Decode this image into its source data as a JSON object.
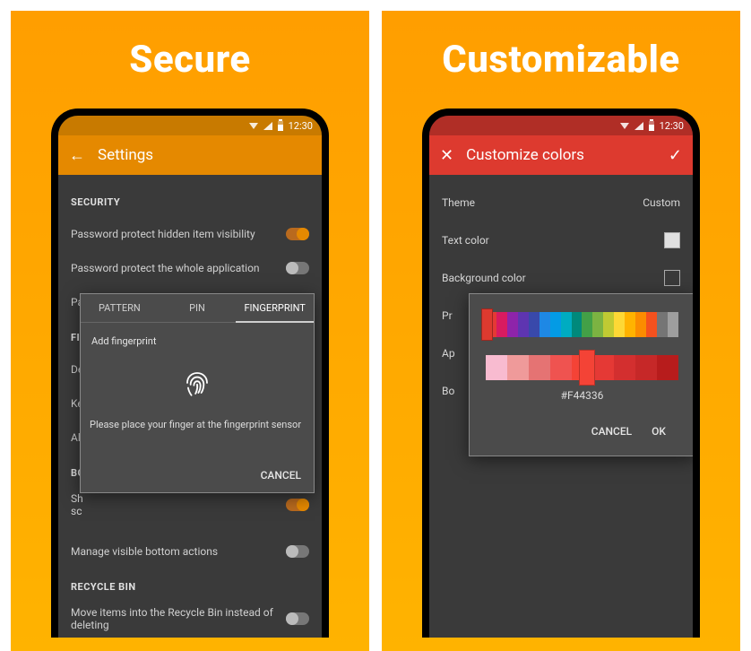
{
  "promos": {
    "left": "Secure",
    "right": "Customizable"
  },
  "statusbar": {
    "time": "12:30"
  },
  "left": {
    "title": "Settings",
    "sections": {
      "security": {
        "header": "SECURITY",
        "items": [
          "Password protect hidden item visibility",
          "Password protect the whole application",
          "Password protect file deletion and moving"
        ]
      },
      "fi": {
        "header": "FI",
        "items": [
          "De",
          "Ke",
          "Al"
        ]
      },
      "bo": {
        "header": "BO",
        "item": "Sh\nsc"
      },
      "bottom": "Manage visible bottom actions",
      "recycle": {
        "header": "RECYCLE BIN",
        "item": "Move items into the Recycle Bin instead of deleting"
      }
    },
    "dialog": {
      "tabs": [
        "PATTERN",
        "PIN",
        "FINGERPRINT"
      ],
      "subtitle": "Add fingerprint",
      "prompt": "Please place your finger at the fingerprint sensor",
      "cancel": "CANCEL"
    }
  },
  "right": {
    "title": "Customize colors",
    "theme_label": "Theme",
    "theme_value": "Custom",
    "options": [
      {
        "label": "Text color",
        "color": "#e0e0e0"
      },
      {
        "label": "Background color",
        "color": "#3a3a3a"
      },
      {
        "label": "Pr",
        "color": "#f44336"
      },
      {
        "label": "Ap",
        "color": "#f44336"
      },
      {
        "label": "Bo",
        "color": "#3a3a3a"
      }
    ],
    "dialog": {
      "hue_colors": [
        "#e53935",
        "#d81b60",
        "#8e24aa",
        "#5e35b1",
        "#3949ab",
        "#1e88e5",
        "#039be5",
        "#00acc1",
        "#00897b",
        "#43a047",
        "#7cb342",
        "#c0ca33",
        "#fdd835",
        "#ffb300",
        "#fb8c00",
        "#f4511e",
        "#757575",
        "#9e9e9e"
      ],
      "shade_colors": [
        "#f8bbd0",
        "#ef9a9a",
        "#e57373",
        "#ef5350",
        "#f44336",
        "#e53935",
        "#d32f2f",
        "#c62828",
        "#b71c1c"
      ],
      "hex": "#F44336",
      "cancel": "CANCEL",
      "ok": "OK"
    }
  }
}
